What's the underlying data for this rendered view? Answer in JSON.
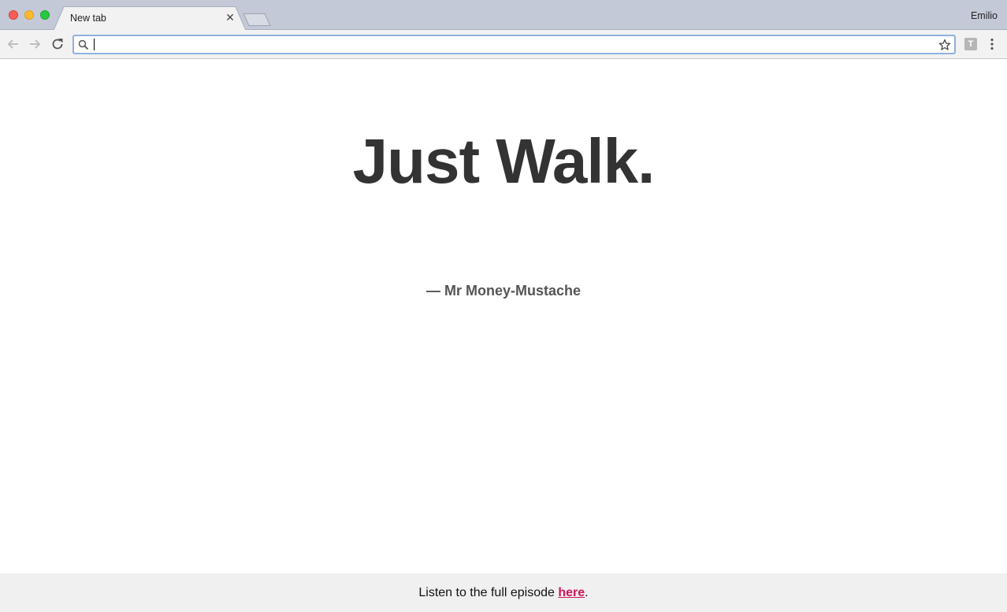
{
  "browser": {
    "tab": {
      "title": "New tab",
      "close_symbol": "✕"
    },
    "profile_name": "Emilio",
    "omnibox": {
      "value": "",
      "placeholder": ""
    },
    "extension_letter": "T",
    "icons": {
      "back": "arrow-left-icon",
      "forward": "arrow-right-icon",
      "reload": "reload-icon",
      "search": "search-icon",
      "bookmark": "star-icon",
      "menu": "kebab-menu-icon"
    }
  },
  "page": {
    "quote": "Just Walk.",
    "attribution": "— Mr Money-Mustache",
    "footer": {
      "text_before": "Listen to the full episode ",
      "link_text": "here",
      "text_after": "."
    }
  },
  "colors": {
    "quote": "#333333",
    "attribution": "#555555",
    "link": "#d0155c",
    "footer_bg": "#f0f0f0"
  }
}
